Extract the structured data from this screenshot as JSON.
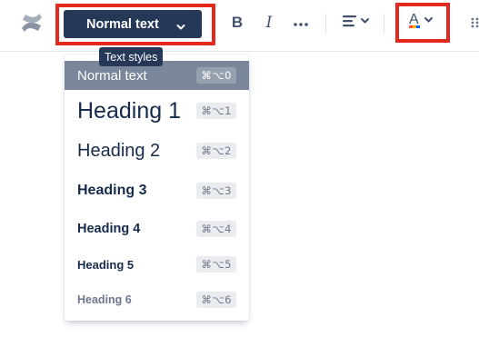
{
  "toolbar": {
    "text_style_label": "Normal text",
    "bold_label": "B",
    "italic_label": "I",
    "font_color_letter": "A",
    "icons": [
      "confluence-logo",
      "chevron-down-icon",
      "bold-icon",
      "italic-icon",
      "more-icon",
      "align-icon",
      "font-color-icon"
    ]
  },
  "tooltip": {
    "text": "Text styles"
  },
  "menu": {
    "items": [
      {
        "label": "Normal text",
        "shortcut": "⌘⌥0",
        "active": true
      },
      {
        "label": "Heading 1",
        "shortcut": "⌘⌥1"
      },
      {
        "label": "Heading 2",
        "shortcut": "⌘⌥2"
      },
      {
        "label": "Heading 3",
        "shortcut": "⌘⌥3"
      },
      {
        "label": "Heading 4",
        "shortcut": "⌘⌥4"
      },
      {
        "label": "Heading 5",
        "shortcut": "⌘⌥5"
      },
      {
        "label": "Heading 6",
        "shortcut": "⌘⌥6"
      }
    ]
  },
  "colors": {
    "highlight": "#e5281e",
    "button_dark": "#253858",
    "active_item": "#7a869a",
    "text": "#172b4d"
  }
}
